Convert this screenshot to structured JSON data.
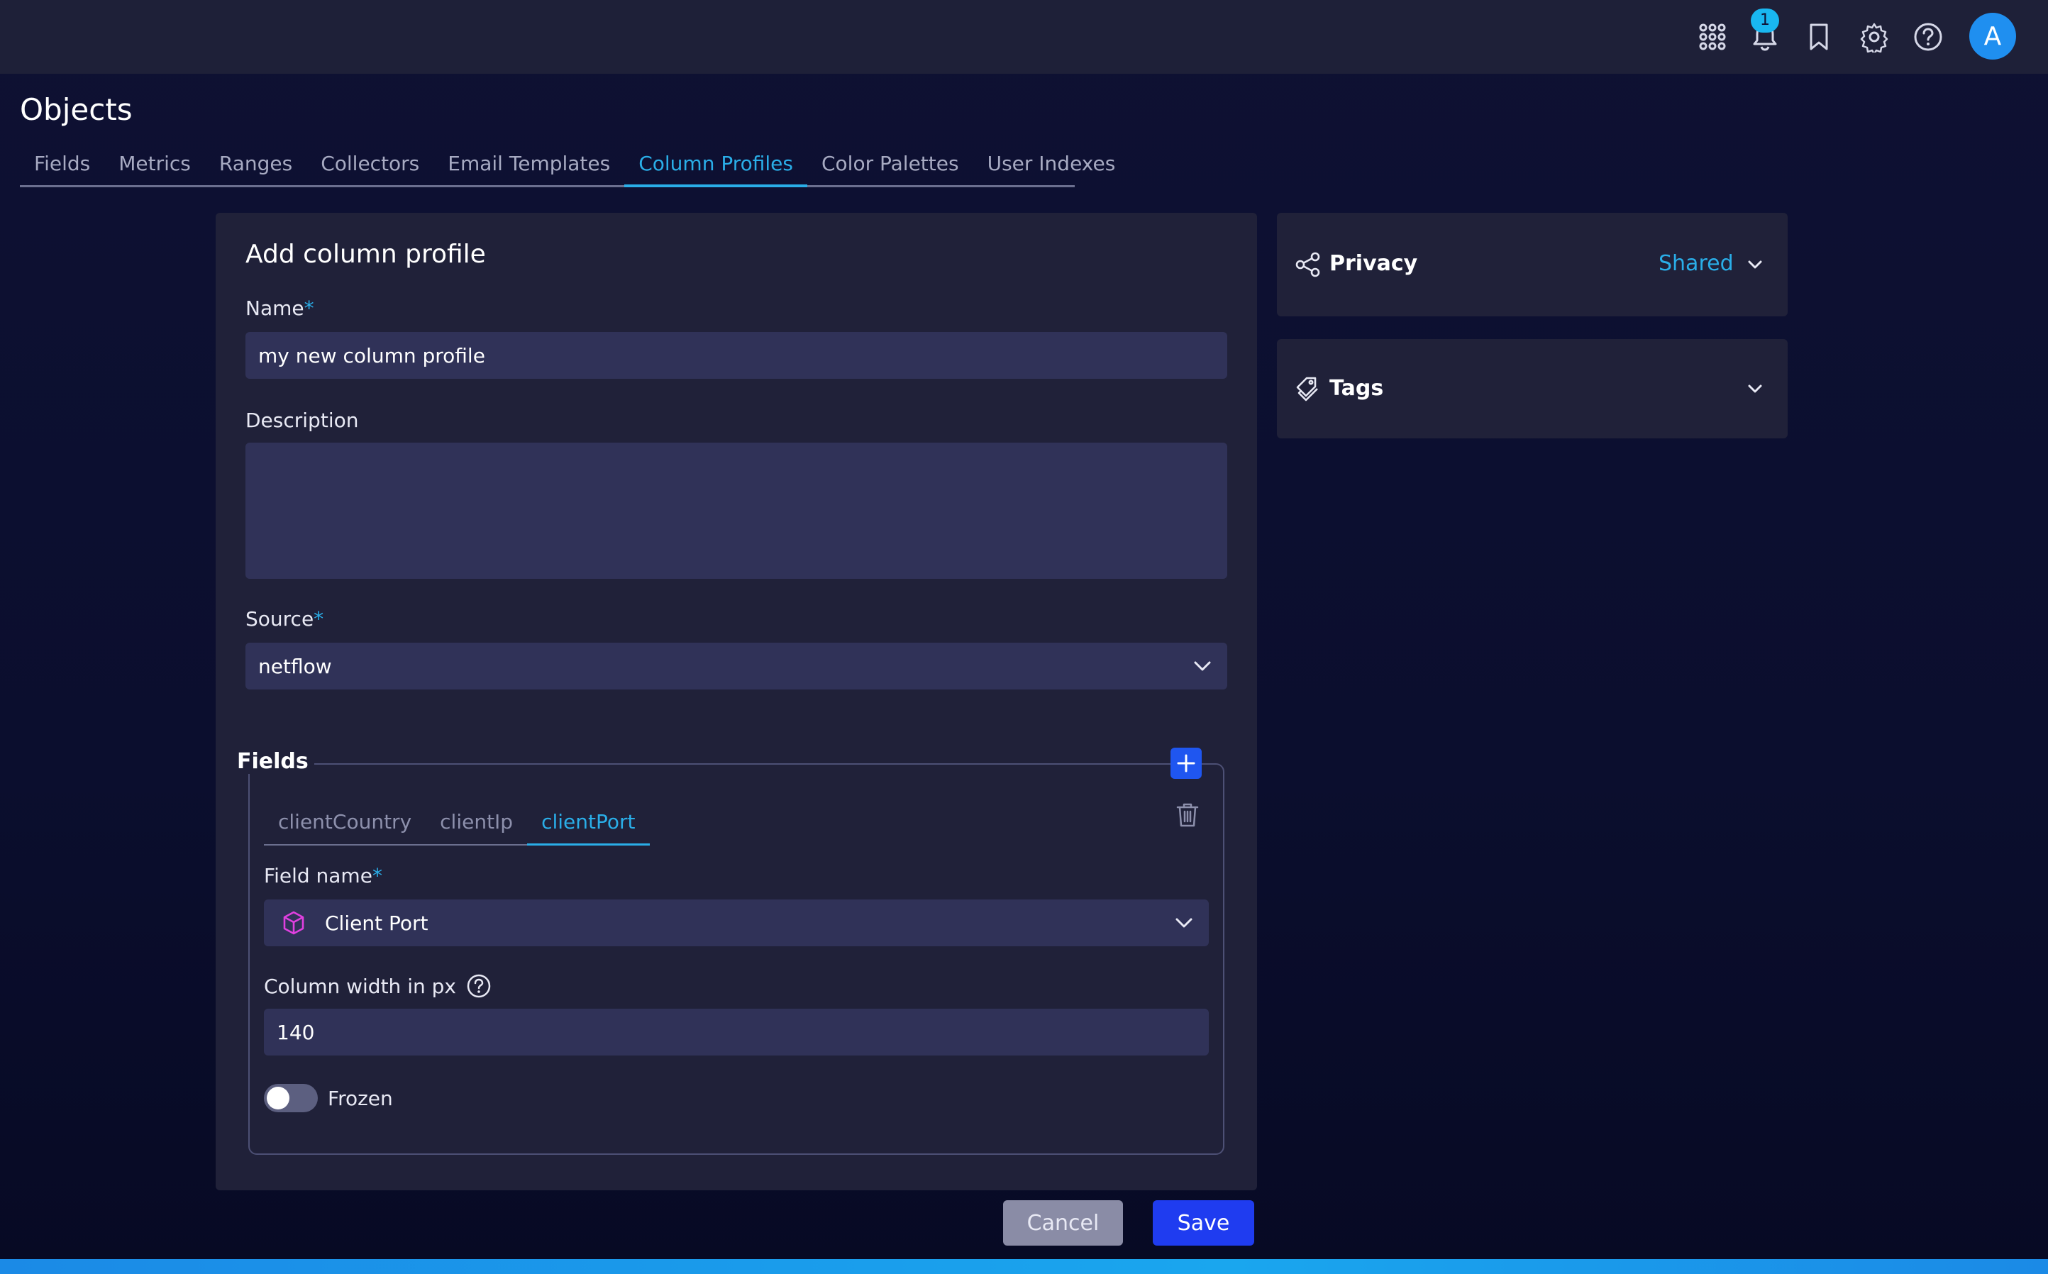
{
  "header": {
    "notification_count": "1",
    "avatar_initial": "A",
    "icons": [
      "apps-grid-icon",
      "bell-icon",
      "bookmark-icon",
      "gear-icon",
      "help-icon"
    ]
  },
  "page": {
    "title": "Objects",
    "tabs": [
      {
        "label": "Fields"
      },
      {
        "label": "Metrics"
      },
      {
        "label": "Ranges"
      },
      {
        "label": "Collectors"
      },
      {
        "label": "Email Templates"
      },
      {
        "label": "Column Profiles",
        "active": true
      },
      {
        "label": "Color Palettes"
      },
      {
        "label": "User Indexes"
      }
    ]
  },
  "form": {
    "title": "Add column profile",
    "name": {
      "label": "Name",
      "required_mark": "*",
      "value": "my new column profile"
    },
    "description": {
      "label": "Description",
      "value": ""
    },
    "source": {
      "label": "Source",
      "required_mark": "*",
      "value": "netflow"
    },
    "fields": {
      "legend": "Fields",
      "tabs": [
        {
          "label": "clientCountry"
        },
        {
          "label": "clientIp"
        },
        {
          "label": "clientPort",
          "active": true
        }
      ],
      "field_name": {
        "label": "Field name",
        "required_mark": "*",
        "value": "Client Port"
      },
      "column_width": {
        "label": "Column width in px",
        "value": "140"
      },
      "frozen": {
        "label": "Frozen",
        "on": false
      }
    },
    "buttons": {
      "cancel": "Cancel",
      "save": "Save"
    }
  },
  "side": {
    "privacy": {
      "label": "Privacy",
      "value": "Shared"
    },
    "tags": {
      "label": "Tags"
    }
  },
  "colors": {
    "accent": "#2aaee8",
    "primary_button": "#1f3cf0",
    "field_icon": "#e040e0"
  }
}
